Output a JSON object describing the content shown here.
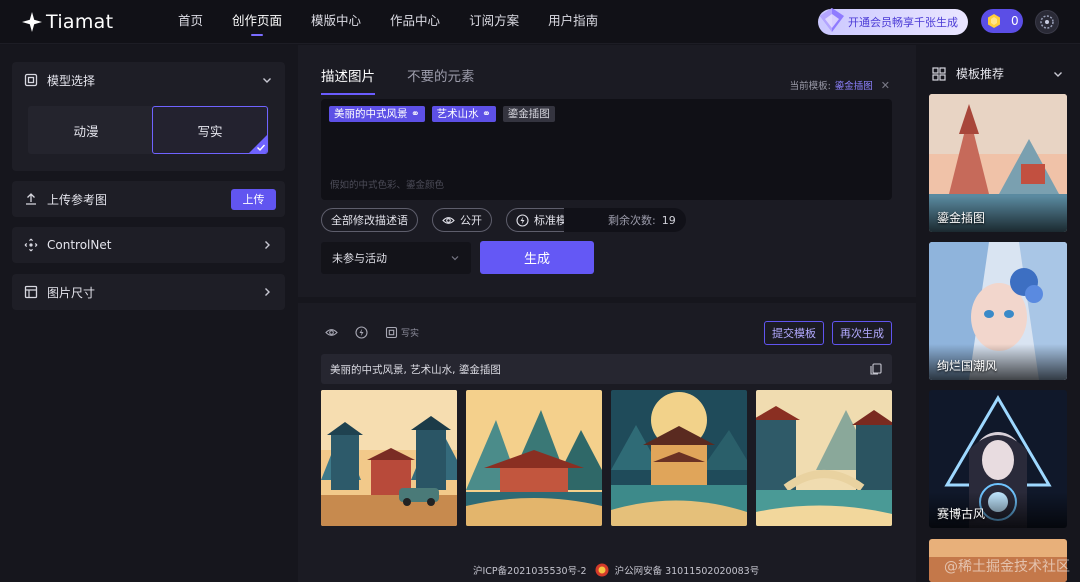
{
  "app": {
    "name": "Tiamat"
  },
  "nav": {
    "items": [
      {
        "label": "首页",
        "active": false
      },
      {
        "label": "创作页面",
        "active": true
      },
      {
        "label": "模版中心",
        "active": false
      },
      {
        "label": "作品中心",
        "active": false
      },
      {
        "label": "订阅方案",
        "active": false
      },
      {
        "label": "用户指南",
        "active": false
      }
    ]
  },
  "header": {
    "promo_label": "开通会员畅享千张生成",
    "coins": "0"
  },
  "left": {
    "model": {
      "title": "模型选择",
      "options": [
        "动漫",
        "写实"
      ],
      "selected": "写实"
    },
    "upload": {
      "title": "上传参考图",
      "button": "上传"
    },
    "controlnet": {
      "title": "ControlNet"
    },
    "size": {
      "title": "图片尺寸"
    }
  },
  "editor": {
    "tabs": [
      "描述图片",
      "不要的元素"
    ],
    "current_template_label": "当前模板:",
    "current_template_value": "鎏金插图",
    "tags": [
      "美丽的中式风景",
      "艺术山水",
      "鎏金插图"
    ],
    "placeholder": "假如的中式色彩、鎏金颜色",
    "chips": {
      "rewrite": "全部修改描述语",
      "public": "公开",
      "mode": "标准模式"
    },
    "remaining_label": "剩余次数:",
    "remaining_value": "19",
    "activity_select": "未参与活动",
    "generate_button": "生成"
  },
  "result": {
    "style_label": "写实",
    "submit_template": "提交模板",
    "regenerate": "再次生成",
    "prompt": "美丽的中式风景, 艺术山水, 鎏金插图"
  },
  "footer": {
    "icp": "沪ICP备2021035530号-2",
    "police": "沪公网安备 31011502020083号"
  },
  "right": {
    "title": "模板推荐",
    "templates": [
      "鎏金插图",
      "绚烂国潮风",
      "赛博古风"
    ]
  },
  "watermark": "@稀土掘金技术社区",
  "colors": {
    "accent": "#6458f5",
    "accent_text": "#8d82ff",
    "bg": "#15151c"
  }
}
